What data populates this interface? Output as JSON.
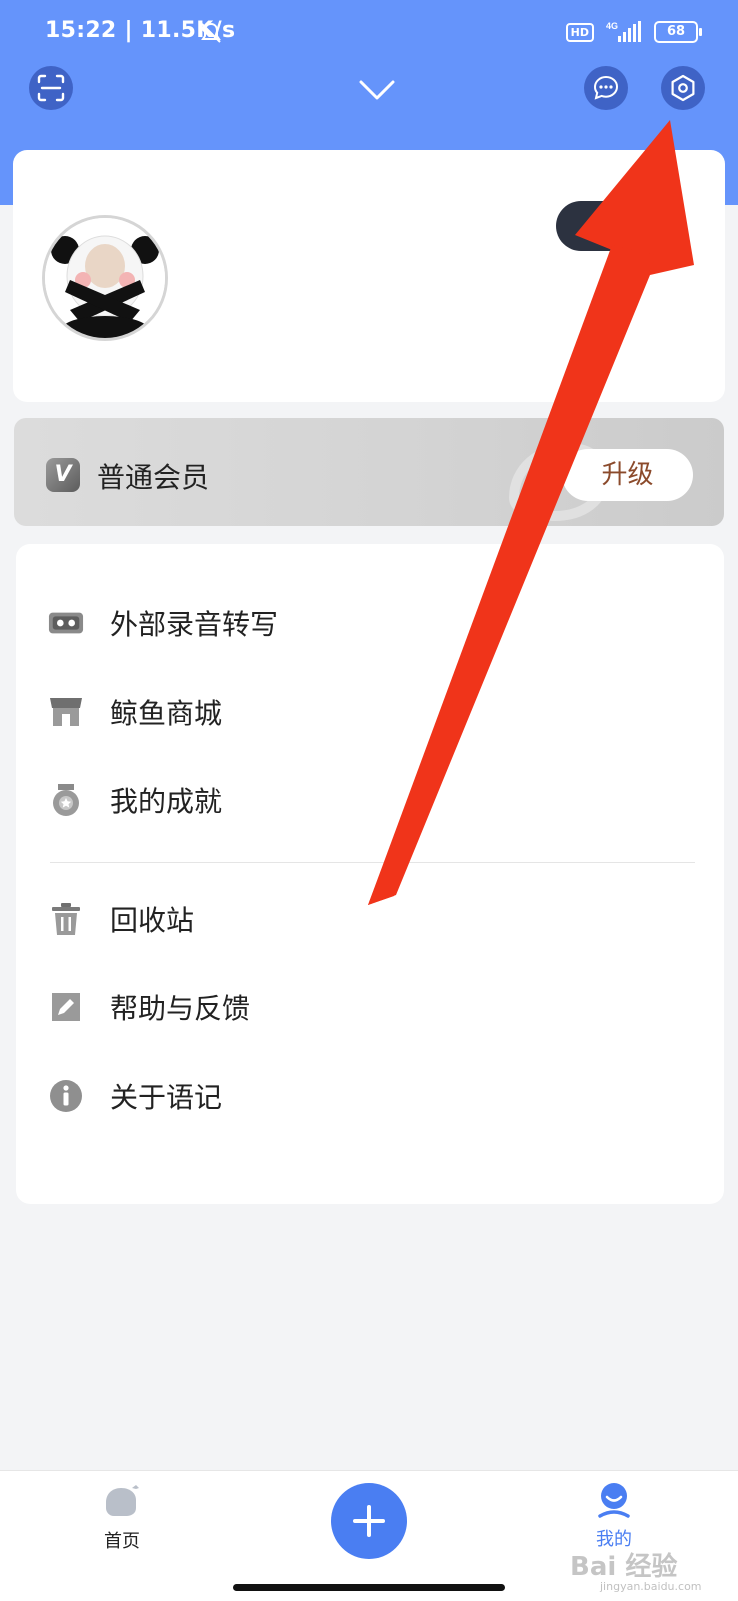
{
  "status_bar": {
    "time": "15:22 | 11.5K/s",
    "hd": "HD",
    "network": "4G",
    "battery": "68"
  },
  "header": {
    "left_icon": "scan-icon",
    "center_icon": "chevron-down-icon",
    "chat_icon": "chat-bubble-icon",
    "settings_icon": "settings-hexagon-icon"
  },
  "membership": {
    "badge": "V",
    "label": "普通会员",
    "upgrade_label": "升级"
  },
  "menu": {
    "group1": [
      {
        "label": "外部录音转写",
        "icon": "recorder-icon"
      },
      {
        "label": "鲸鱼商城",
        "icon": "store-icon"
      },
      {
        "label": "我的成就",
        "icon": "medal-icon"
      }
    ],
    "group2": [
      {
        "label": "回收站",
        "icon": "trash-icon"
      },
      {
        "label": "帮助与反馈",
        "icon": "edit-icon"
      },
      {
        "label": "关于语记",
        "icon": "info-icon"
      }
    ]
  },
  "tabbar": {
    "home_label": "首页",
    "add_icon": "plus-icon",
    "me_label": "我的"
  },
  "watermark": {
    "text": "Bai 经验",
    "sub": "jingyan.baidu.com"
  },
  "colors": {
    "header": "#6594fb",
    "accent": "#4a7ef2",
    "arrow": "#f0341a",
    "upgrade_text": "#8b4a2b"
  }
}
